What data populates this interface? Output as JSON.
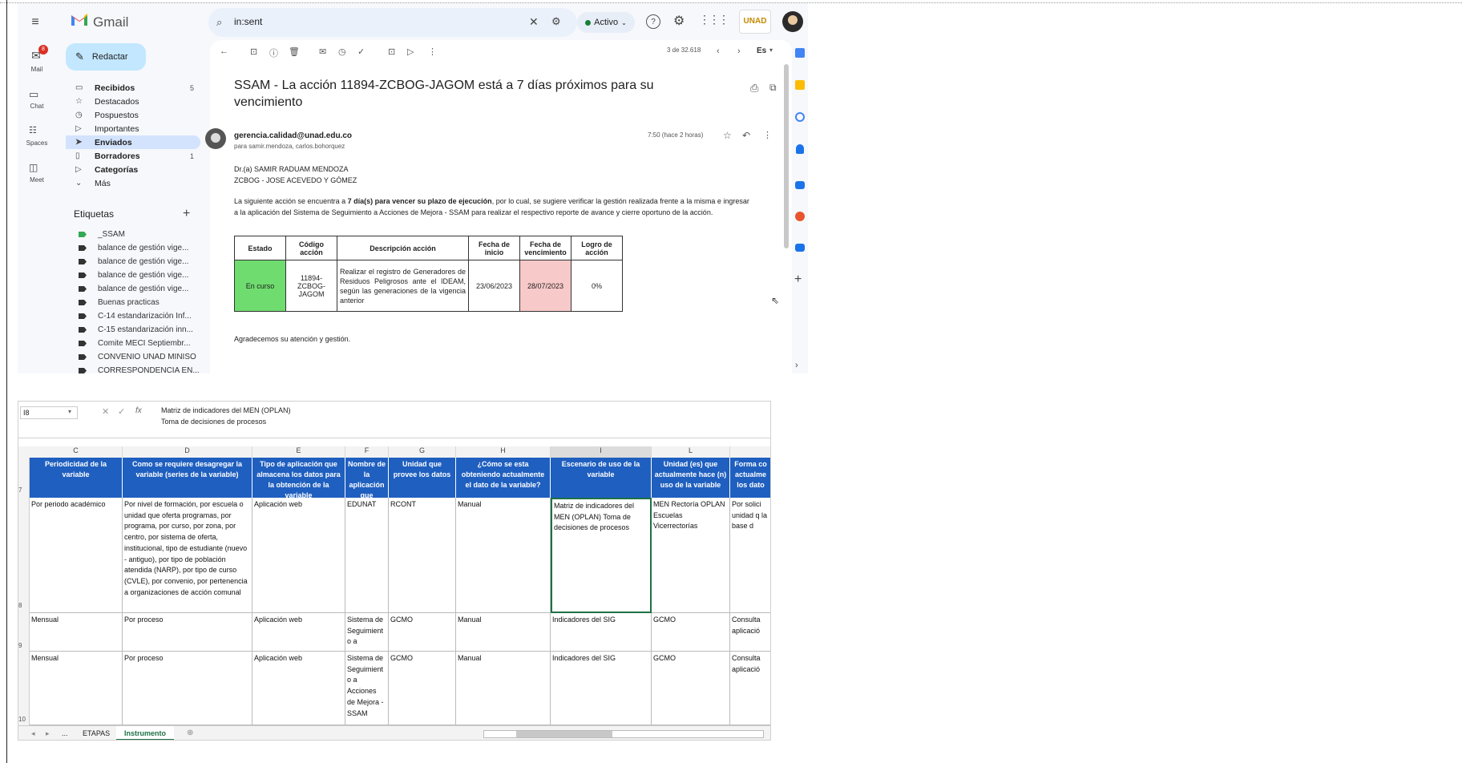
{
  "colors": {
    "gmail_bg": "#f6f8fc",
    "accent": "#c2e7ff",
    "selected": "#d3e3fd",
    "excel_header": "#1f5fbf",
    "cell_green": "#6fdc6f",
    "cell_red": "#f8c9c9"
  },
  "gmail": {
    "app_name": "Gmail",
    "search_query": "in:sent",
    "status": "Activo",
    "rail": {
      "mail": "Mail",
      "mail_badge": "8",
      "chat": "Chat",
      "spaces": "Spaces",
      "meet": "Meet"
    },
    "compose": "Redactar",
    "nav": [
      {
        "label": "Recibidos",
        "count": "5",
        "icon": "inbox-icon",
        "glyph": "▭"
      },
      {
        "label": "Destacados",
        "count": "",
        "icon": "star-icon",
        "glyph": "☆"
      },
      {
        "label": "Pospuestos",
        "count": "",
        "icon": "clock-icon",
        "glyph": "◷"
      },
      {
        "label": "Importantes",
        "count": "",
        "icon": "important-icon",
        "glyph": "▷"
      },
      {
        "label": "Enviados",
        "count": "",
        "icon": "send-icon",
        "glyph": "➤"
      },
      {
        "label": "Borradores",
        "count": "1",
        "icon": "draft-icon",
        "glyph": "▯"
      },
      {
        "label": "Categorías",
        "count": "",
        "icon": "label-icon",
        "glyph": "▷"
      },
      {
        "label": "Más",
        "count": "",
        "icon": "chevron-down-icon",
        "glyph": "⌄"
      }
    ],
    "labels_title": "Etiquetas",
    "labels": [
      "_SSAM",
      "balance de gestión vige...",
      "balance de gestión vige...",
      "balance de gestión vige...",
      "balance de gestión vige...",
      "Buenas practicas",
      "C-14 estandarización Inf...",
      "C-15 estandarización inn...",
      "Comite MECI Septiembr...",
      "CONVENIO UNAD MINISO",
      "CORRESPONDENCIA EN..."
    ],
    "pager": "3 de 32.618",
    "lang": "Es",
    "subject": "SSAM - La acción 11894-ZCBOG-JAGOM está a 7 días próximos para su vencimiento",
    "sender": "gerencia.calidad@unad.edu.co",
    "recipients": "para samir.mendoza, carlos.bohorquez",
    "time": "7:50 (hace 2 horas)",
    "greeting1": "Dr.(a) SAMIR RADUAM MENDOZA",
    "greeting2": "ZCBOG - JOSE ACEVEDO Y GÓMEZ",
    "para_a": "La siguiente acción se encuentra a ",
    "para_bold": "7 día(s) para vencer su plazo de ejecución",
    "para_b": ", por lo cual, se sugiere verificar la gestión realizada frente a la misma e ingresar a la aplicación del Sistema de Seguimiento a Acciones de Mejora - SSAM para realizar el respectivo reporte de avance y cierre oportuno de la acción.",
    "table": {
      "headers": [
        "Estado",
        "Código acción",
        "Descripción acción",
        "Fecha de inicio",
        "Fecha de vencimiento",
        "Logro de acción"
      ],
      "row": [
        "En curso",
        "11894-ZCBOG-JAGOM",
        "Realizar el registro de Generadores de Residuos Peligrosos ante el IDEAM, según las generaciones de la vigencia anterior",
        "23/06/2023",
        "28/07/2023",
        "0%"
      ]
    },
    "closing": "Agradecemos su atención y gestión."
  },
  "excel": {
    "name_box": "I8",
    "formula_line1": "Matriz de indicadores del MEN (OPLAN)",
    "formula_line2": "Toma de decisiones de procesos",
    "col_letters": [
      "C",
      "D",
      "E",
      "F",
      "G",
      "H",
      "I",
      "L"
    ],
    "headers": [
      "Periodicidad de la variable",
      "Como se requiere desagregar la variable (series de la variable)",
      "Tipo de aplicación que almacena los datos para la obtención de la variable",
      "Nombre de la aplicación que",
      "Unidad que provee los datos",
      "¿Cómo se esta obteniendo actualmente el dato de la variable?",
      "Escenario de uso de la variable",
      "Unidad (es) que actualmente hace (n) uso de la variable",
      "Forma co actualme los dato"
    ],
    "rows": [
      {
        "num": "8",
        "cells": [
          "Por periodo académico",
          "Por nivel de formación, por escuela o unidad que oferta programas, por programa, por curso, por zona, por centro, por sistema de oferta, institucional, tipo de estudiante (nuevo - antiguo), por tipo de población atendida (NARP), por tipo de curso (CVLE), por convenio, por pertenencia a organizaciones de acción comunal",
          "Aplicación web",
          "EDUNAT",
          "RCONT",
          "Manual",
          "Matriz de indicadores del MEN (OPLAN) Toma de decisiones de procesos",
          "MEN Rectoría OPLAN Escuelas Vicerrectorías",
          "Por solici unidad q la base d"
        ]
      },
      {
        "num": "9",
        "cells": [
          "Mensual",
          "Por proceso",
          "Aplicación web",
          "Sistema de Seguimient o a",
          "GCMO",
          "Manual",
          "Indicadores del SIG",
          "GCMO",
          "Consulta aplicació"
        ]
      },
      {
        "num": "10",
        "cells": [
          "Mensual",
          "Por proceso",
          "Aplicación web",
          "Sistema de Seguimient o a Acciones de Mejora - SSAM",
          "GCMO",
          "Manual",
          "Indicadores del SIG",
          "GCMO",
          "Consulta aplicació"
        ]
      }
    ],
    "sheet_tabs": [
      "...",
      "ETAPAS",
      "Instrumento"
    ]
  }
}
